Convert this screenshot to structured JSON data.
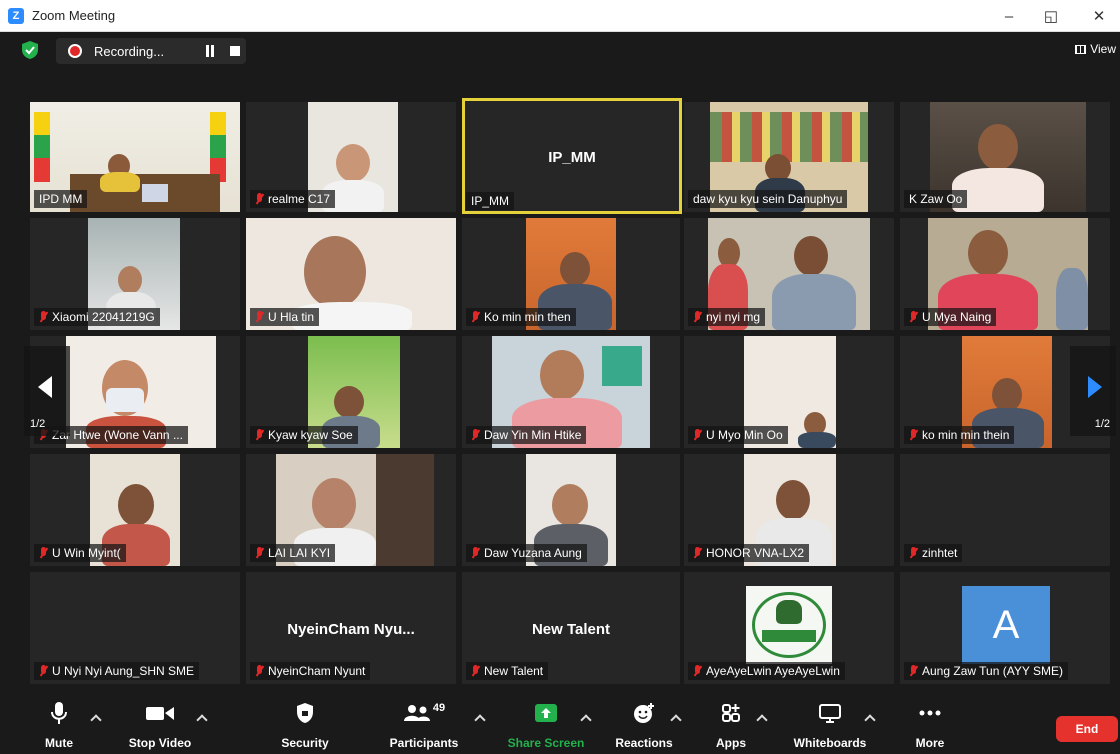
{
  "window": {
    "title": "Zoom Meeting",
    "minimize": "–",
    "restore": "◱",
    "close": "✕"
  },
  "topbar": {
    "recording_label": "Recording...",
    "view_label": "View"
  },
  "pager": {
    "page_left": "1/2",
    "page_right": "1/2"
  },
  "participants": [
    {
      "name": "IPD MM",
      "muted": false
    },
    {
      "name": "realme C17",
      "muted": true
    },
    {
      "name": "IP_MM",
      "muted": false,
      "display_name": "IP_MM",
      "active_speaker": true
    },
    {
      "name": "daw kyu kyu sein Danuphyu",
      "muted": false
    },
    {
      "name": "K Zaw Oo",
      "muted": false
    },
    {
      "name": "Xiaomi 22041219G",
      "muted": true
    },
    {
      "name": "U Hla tin",
      "muted": true
    },
    {
      "name": "Ko min min then",
      "muted": true
    },
    {
      "name": "nyi nyi mg",
      "muted": true
    },
    {
      "name": "U Mya Naing",
      "muted": true
    },
    {
      "name": "Zar Htwe (Wone Vann ...",
      "muted": true
    },
    {
      "name": "Kyaw kyaw Soe",
      "muted": true
    },
    {
      "name": "Daw Yin Min Htike",
      "muted": true
    },
    {
      "name": "U Myo Min Oo",
      "muted": true
    },
    {
      "name": "ko min min thein",
      "muted": true
    },
    {
      "name": "U Win Myint(",
      "muted": true
    },
    {
      "name": "LAI LAI KYI",
      "muted": true
    },
    {
      "name": "Daw Yuzana Aung",
      "muted": true
    },
    {
      "name": "HONOR VNA-LX2",
      "muted": true
    },
    {
      "name": "zinhtet",
      "muted": true
    },
    {
      "name": "U Nyi Nyi Aung_SHN SME",
      "muted": true
    },
    {
      "name": "NyeinCham Nyunt",
      "muted": true,
      "display_name": "NyeinCham  Nyu..."
    },
    {
      "name": "New Talent",
      "muted": true,
      "display_name": "New Talent"
    },
    {
      "name": "AyeAyeLwin AyeAyeLwin",
      "muted": true
    },
    {
      "name": "Aung Zaw Tun (AYY SME)",
      "muted": true,
      "avatar_letter": "A"
    }
  ],
  "toolbar": {
    "mute": "Mute",
    "stop_video": "Stop Video",
    "security": "Security",
    "participants": "Participants",
    "participants_count": "49",
    "share_screen": "Share Screen",
    "reactions": "Reactions",
    "apps": "Apps",
    "whiteboards": "Whiteboards",
    "more": "More",
    "end": "End"
  },
  "colors": {
    "accent_blue": "#2d8cff",
    "share_green": "#22b14c",
    "end_red": "#e5322d",
    "mute_red": "#e02828",
    "active_yellow": "#e5d23a"
  }
}
